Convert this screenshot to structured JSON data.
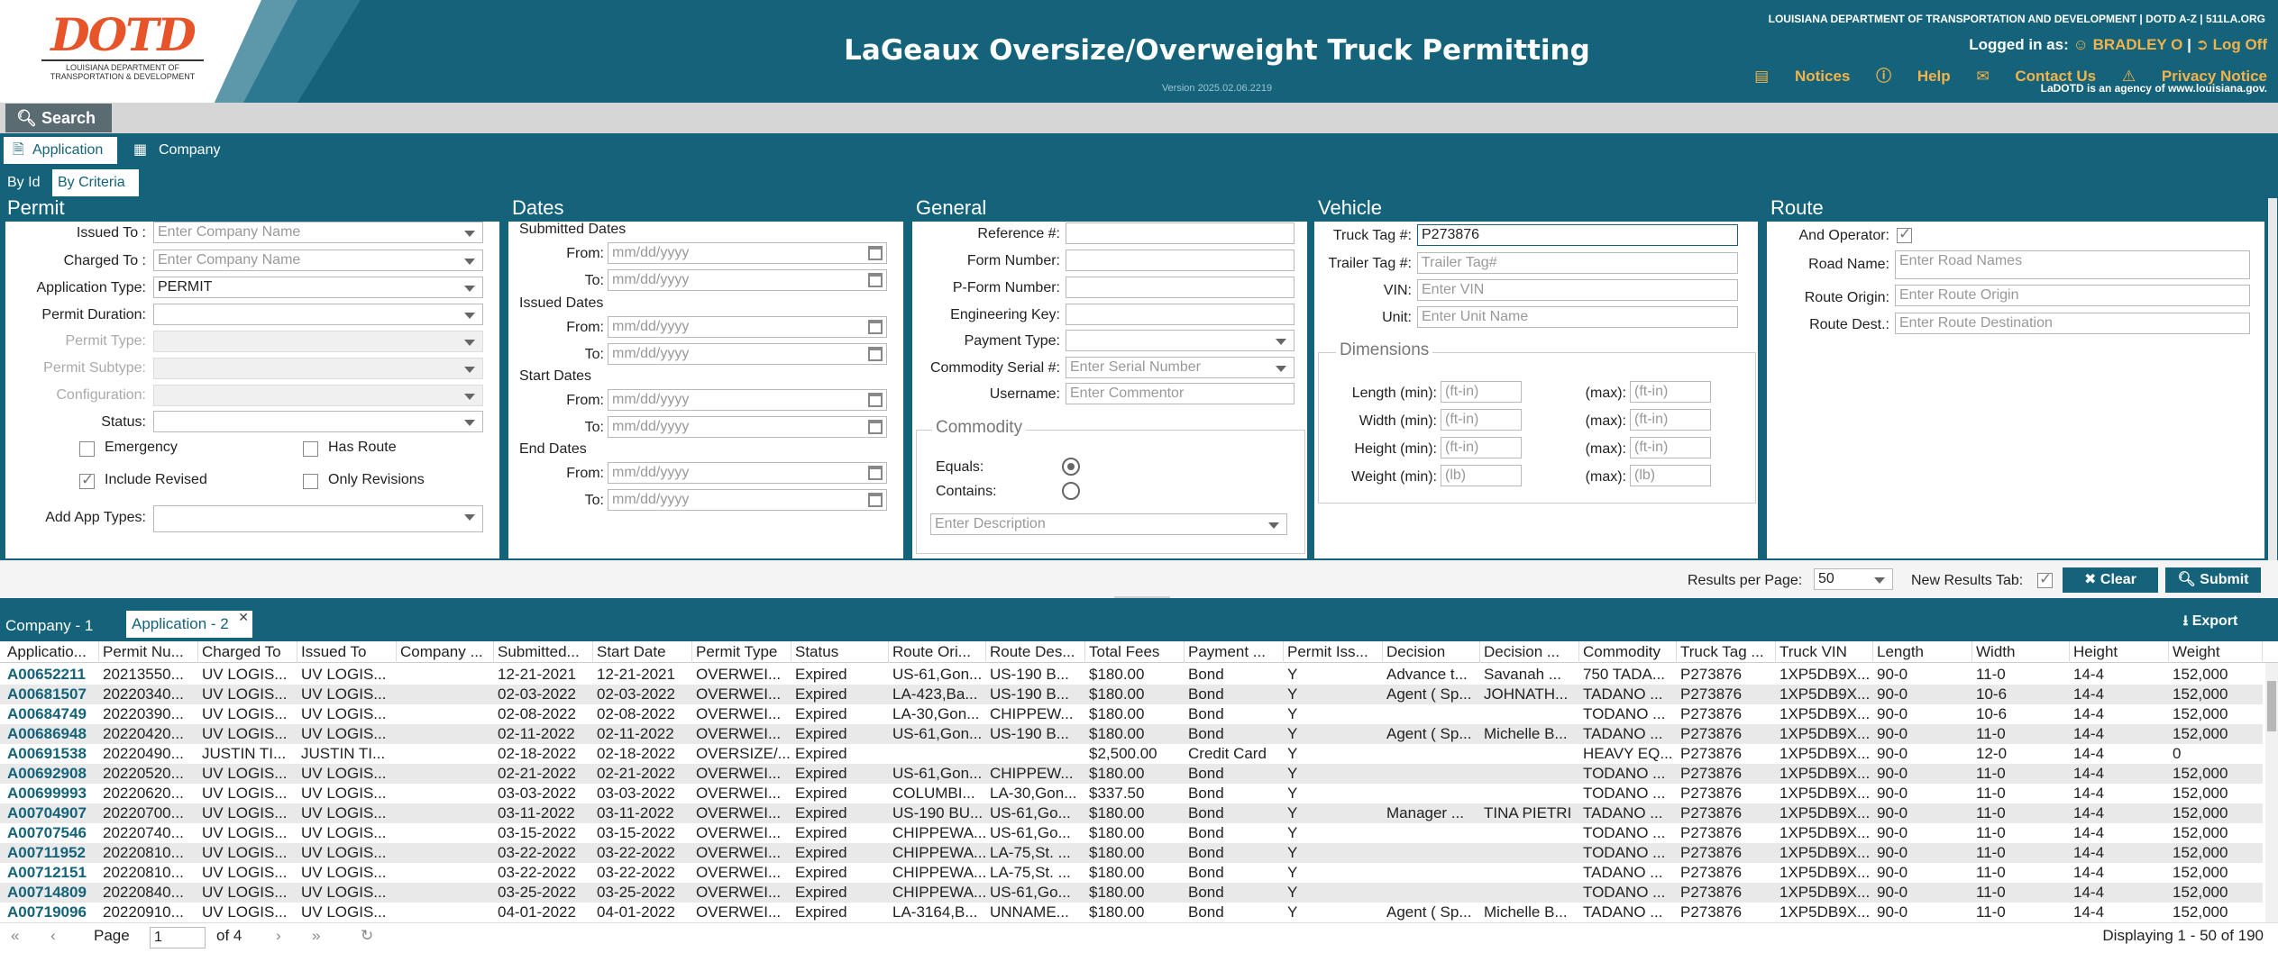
{
  "header": {
    "logo_text": "DOTD",
    "logo_sub": "LOUISIANA DEPARTMENT OF TRANSPORTATION & DEVELOPMENT",
    "title": "LaGeaux Oversize/Overweight Truck Permitting",
    "version": "Version 2025.02.06.2219",
    "topline": "LOUISIANA DEPARTMENT OF TRANSPORTATION AND DEVELOPMENT | DOTD A-Z | 511LA.ORG",
    "logged_in_label": "Logged in as:",
    "user": "BRADLEY O",
    "logoff": "Log Off",
    "notices": "Notices",
    "help": "Help",
    "contact": "Contact Us",
    "privacy": "Privacy Notice",
    "agency": "LaDOTD is an agency of www.louisiana.gov."
  },
  "search_tab": "Search",
  "subtabs": {
    "application": "Application",
    "company": "Company"
  },
  "mode_tabs": {
    "by_id": "By Id",
    "by_criteria": "By Criteria"
  },
  "permit": {
    "title": "Permit",
    "issued_to_label": "Issued To :",
    "issued_to_ph": "Enter Company Name",
    "charged_to_label": "Charged To :",
    "charged_to_ph": "Enter Company Name",
    "app_type_label": "Application Type:",
    "app_type_value": "PERMIT",
    "duration_label": "Permit Duration:",
    "type_label": "Permit Type:",
    "subtype_label": "Permit Subtype:",
    "config_label": "Configuration:",
    "status_label": "Status:",
    "emergency": "Emergency",
    "has_route": "Has Route",
    "include_revised": "Include Revised",
    "only_revisions": "Only Revisions",
    "add_app_types": "Add App Types:"
  },
  "dates": {
    "title": "Dates",
    "submitted": "Submitted Dates",
    "issued": "Issued Dates",
    "start": "Start Dates",
    "end": "End Dates",
    "from": "From:",
    "to": "To:",
    "placeholder": "mm/dd/yyyy"
  },
  "general": {
    "title": "General",
    "reference": "Reference #:",
    "form_number": "Form Number:",
    "pform": "P-Form Number:",
    "eng_key": "Engineering Key:",
    "payment_type": "Payment Type:",
    "commodity_serial": "Commodity Serial #:",
    "serial_ph": "Enter Serial Number",
    "username": "Username:",
    "username_ph": "Enter Commentor",
    "commodity": "Commodity",
    "equals": "Equals:",
    "contains": "Contains:",
    "desc_ph": "Enter Description"
  },
  "vehicle": {
    "title": "Vehicle",
    "truck_tag": "Truck Tag #:",
    "truck_tag_value": "P273876",
    "trailer_tag": "Trailer Tag #:",
    "trailer_ph": "Trailer Tag#",
    "vin": "VIN:",
    "vin_ph": "Enter VIN",
    "unit": "Unit:",
    "unit_ph": "Enter Unit Name",
    "dimensions": "Dimensions",
    "length": "Length (min):",
    "width": "Width (min):",
    "height": "Height (min):",
    "weight": "Weight (min):",
    "max": "(max):",
    "ftin": "(ft-in)",
    "lb": "(lb)"
  },
  "route": {
    "title": "Route",
    "and_operator": "And Operator:",
    "road_name": "Road Name:",
    "road_ph": "Enter Road Names",
    "origin": "Route Origin:",
    "origin_ph": "Enter Route Origin",
    "dest": "Route Dest.:",
    "dest_ph": "Enter Route Destination"
  },
  "toolbar": {
    "results_per_page": "Results per Page:",
    "results_value": "50",
    "new_results_tab": "New Results Tab:",
    "clear": "Clear",
    "submit": "Submit",
    "export": "Export"
  },
  "result_tabs": [
    "Company - 1",
    "Application - 2"
  ],
  "columns": [
    "Applicatio...",
    "Permit Nu...",
    "Charged To",
    "Issued To",
    "Company ...",
    "Submitted...",
    "Start Date",
    "Permit Type",
    "Status",
    "Route Ori...",
    "Route Des...",
    "Total Fees",
    "Payment ...",
    "Permit Iss...",
    "Decision",
    "Decision ...",
    "Commodity",
    "Truck Tag ...",
    "Truck VIN",
    "Length",
    "Width",
    "Height",
    "Weight"
  ],
  "rows": [
    [
      "A00652211",
      "20213550...",
      "UV LOGIS...",
      "UV LOGIS...",
      "",
      "12-21-2021",
      "12-21-2021",
      "OVERWEI...",
      "Expired",
      "US-61,Gon...",
      "US-190 B...",
      "$180.00",
      "Bond",
      "Y",
      "Advance t...",
      "Savanah ...",
      "750 TADA...",
      "P273876",
      "1XP5DB9X...",
      "90-0",
      "11-0",
      "14-4",
      "152,000"
    ],
    [
      "A00681507",
      "20220340...",
      "UV LOGIS...",
      "UV LOGIS...",
      "",
      "02-03-2022",
      "02-03-2022",
      "OVERWEI...",
      "Expired",
      "LA-423,Ba...",
      "US-190 B...",
      "$180.00",
      "Bond",
      "Y",
      "Agent ( Sp...",
      "JOHNATH...",
      "TADANO ...",
      "P273876",
      "1XP5DB9X...",
      "90-0",
      "10-6",
      "14-4",
      "152,000"
    ],
    [
      "A00684749",
      "20220390...",
      "UV LOGIS...",
      "UV LOGIS...",
      "",
      "02-08-2022",
      "02-08-2022",
      "OVERWEI...",
      "Expired",
      "LA-30,Gon...",
      "CHIPPEW...",
      "$180.00",
      "Bond",
      "Y",
      "",
      "",
      "TODANO ...",
      "P273876",
      "1XP5DB9X...",
      "90-0",
      "10-6",
      "14-4",
      "152,000"
    ],
    [
      "A00686948",
      "20220420...",
      "UV LOGIS...",
      "UV LOGIS...",
      "",
      "02-11-2022",
      "02-11-2022",
      "OVERWEI...",
      "Expired",
      "US-61,Gon...",
      "US-190 B...",
      "$180.00",
      "Bond",
      "Y",
      "Agent ( Sp...",
      "Michelle B...",
      "TADANO ...",
      "P273876",
      "1XP5DB9X...",
      "90-0",
      "11-0",
      "14-4",
      "152,000"
    ],
    [
      "A00691538",
      "20220490...",
      "JUSTIN TI...",
      "JUSTIN TI...",
      "",
      "02-18-2022",
      "02-18-2022",
      "OVERSIZE/...",
      "Expired",
      "",
      "",
      "$2,500.00",
      "Credit Card",
      "Y",
      "",
      "",
      "HEAVY EQ...",
      "P273876",
      "1XP5DB9X...",
      "90-0",
      "12-0",
      "14-4",
      "0"
    ],
    [
      "A00692908",
      "20220520...",
      "UV LOGIS...",
      "UV LOGIS...",
      "",
      "02-21-2022",
      "02-21-2022",
      "OVERWEI...",
      "Expired",
      "US-61,Gon...",
      "CHIPPEW...",
      "$180.00",
      "Bond",
      "Y",
      "",
      "",
      "TODANO ...",
      "P273876",
      "1XP5DB9X...",
      "90-0",
      "11-0",
      "14-4",
      "152,000"
    ],
    [
      "A00699993",
      "20220620...",
      "UV LOGIS...",
      "UV LOGIS...",
      "",
      "03-03-2022",
      "03-03-2022",
      "OVERWEI...",
      "Expired",
      "COLUMBI...",
      "LA-30,Gon...",
      "$337.50",
      "Bond",
      "Y",
      "",
      "",
      "TODANO ...",
      "P273876",
      "1XP5DB9X...",
      "90-0",
      "11-0",
      "14-4",
      "152,000"
    ],
    [
      "A00704907",
      "20220700...",
      "UV LOGIS...",
      "UV LOGIS...",
      "",
      "03-11-2022",
      "03-11-2022",
      "OVERWEI...",
      "Expired",
      "US-190 BU...",
      "US-61,Go...",
      "$180.00",
      "Bond",
      "Y",
      "Manager ...",
      "TINA PIETRI",
      "TADANO ...",
      "P273876",
      "1XP5DB9X...",
      "90-0",
      "11-0",
      "14-4",
      "152,000"
    ],
    [
      "A00707546",
      "20220740...",
      "UV LOGIS...",
      "UV LOGIS...",
      "",
      "03-15-2022",
      "03-15-2022",
      "OVERWEI...",
      "Expired",
      "CHIPPEWA...",
      "US-61,Go...",
      "$180.00",
      "Bond",
      "Y",
      "",
      "",
      "TODANO ...",
      "P273876",
      "1XP5DB9X...",
      "90-0",
      "11-0",
      "14-4",
      "152,000"
    ],
    [
      "A00711952",
      "20220810...",
      "UV LOGIS...",
      "UV LOGIS...",
      "",
      "03-22-2022",
      "03-22-2022",
      "OVERWEI...",
      "Expired",
      "CHIPPEWA...",
      "LA-75,St. ...",
      "$180.00",
      "Bond",
      "Y",
      "",
      "",
      "TODANO ...",
      "P273876",
      "1XP5DB9X...",
      "90-0",
      "11-0",
      "14-4",
      "152,000"
    ],
    [
      "A00712151",
      "20220810...",
      "UV LOGIS...",
      "UV LOGIS...",
      "",
      "03-22-2022",
      "03-22-2022",
      "OVERWEI...",
      "Expired",
      "CHIPPEWA...",
      "LA-75,St. ...",
      "$180.00",
      "Bond",
      "Y",
      "",
      "",
      "TADANO ...",
      "P273876",
      "1XP5DB9X...",
      "90-0",
      "11-0",
      "14-4",
      "152,000"
    ],
    [
      "A00714809",
      "20220840...",
      "UV LOGIS...",
      "UV LOGIS...",
      "",
      "03-25-2022",
      "03-25-2022",
      "OVERWEI...",
      "Expired",
      "CHIPPEWA...",
      "US-61,Go...",
      "$180.00",
      "Bond",
      "Y",
      "",
      "",
      "TODANO ...",
      "P273876",
      "1XP5DB9X...",
      "90-0",
      "11-0",
      "14-4",
      "152,000"
    ],
    [
      "A00719096",
      "20220910...",
      "UV LOGIS...",
      "UV LOGIS...",
      "",
      "04-01-2022",
      "04-01-2022",
      "OVERWEI...",
      "Expired",
      "LA-3164,B...",
      "UNNAME...",
      "$180.00",
      "Bond",
      "Y",
      "Agent ( Sp...",
      "Michelle B...",
      "TADANO ...",
      "P273876",
      "1XP5DB9X...",
      "90-0",
      "11-0",
      "14-4",
      "152,000"
    ]
  ],
  "pager": {
    "page_label": "Page",
    "page_value": "1",
    "of": "of 4",
    "displaying": "Displaying 1 - 50 of 190"
  },
  "colors": {
    "teal": "#14637a",
    "orange": "#f4b24a",
    "logo": "#e8542a"
  }
}
